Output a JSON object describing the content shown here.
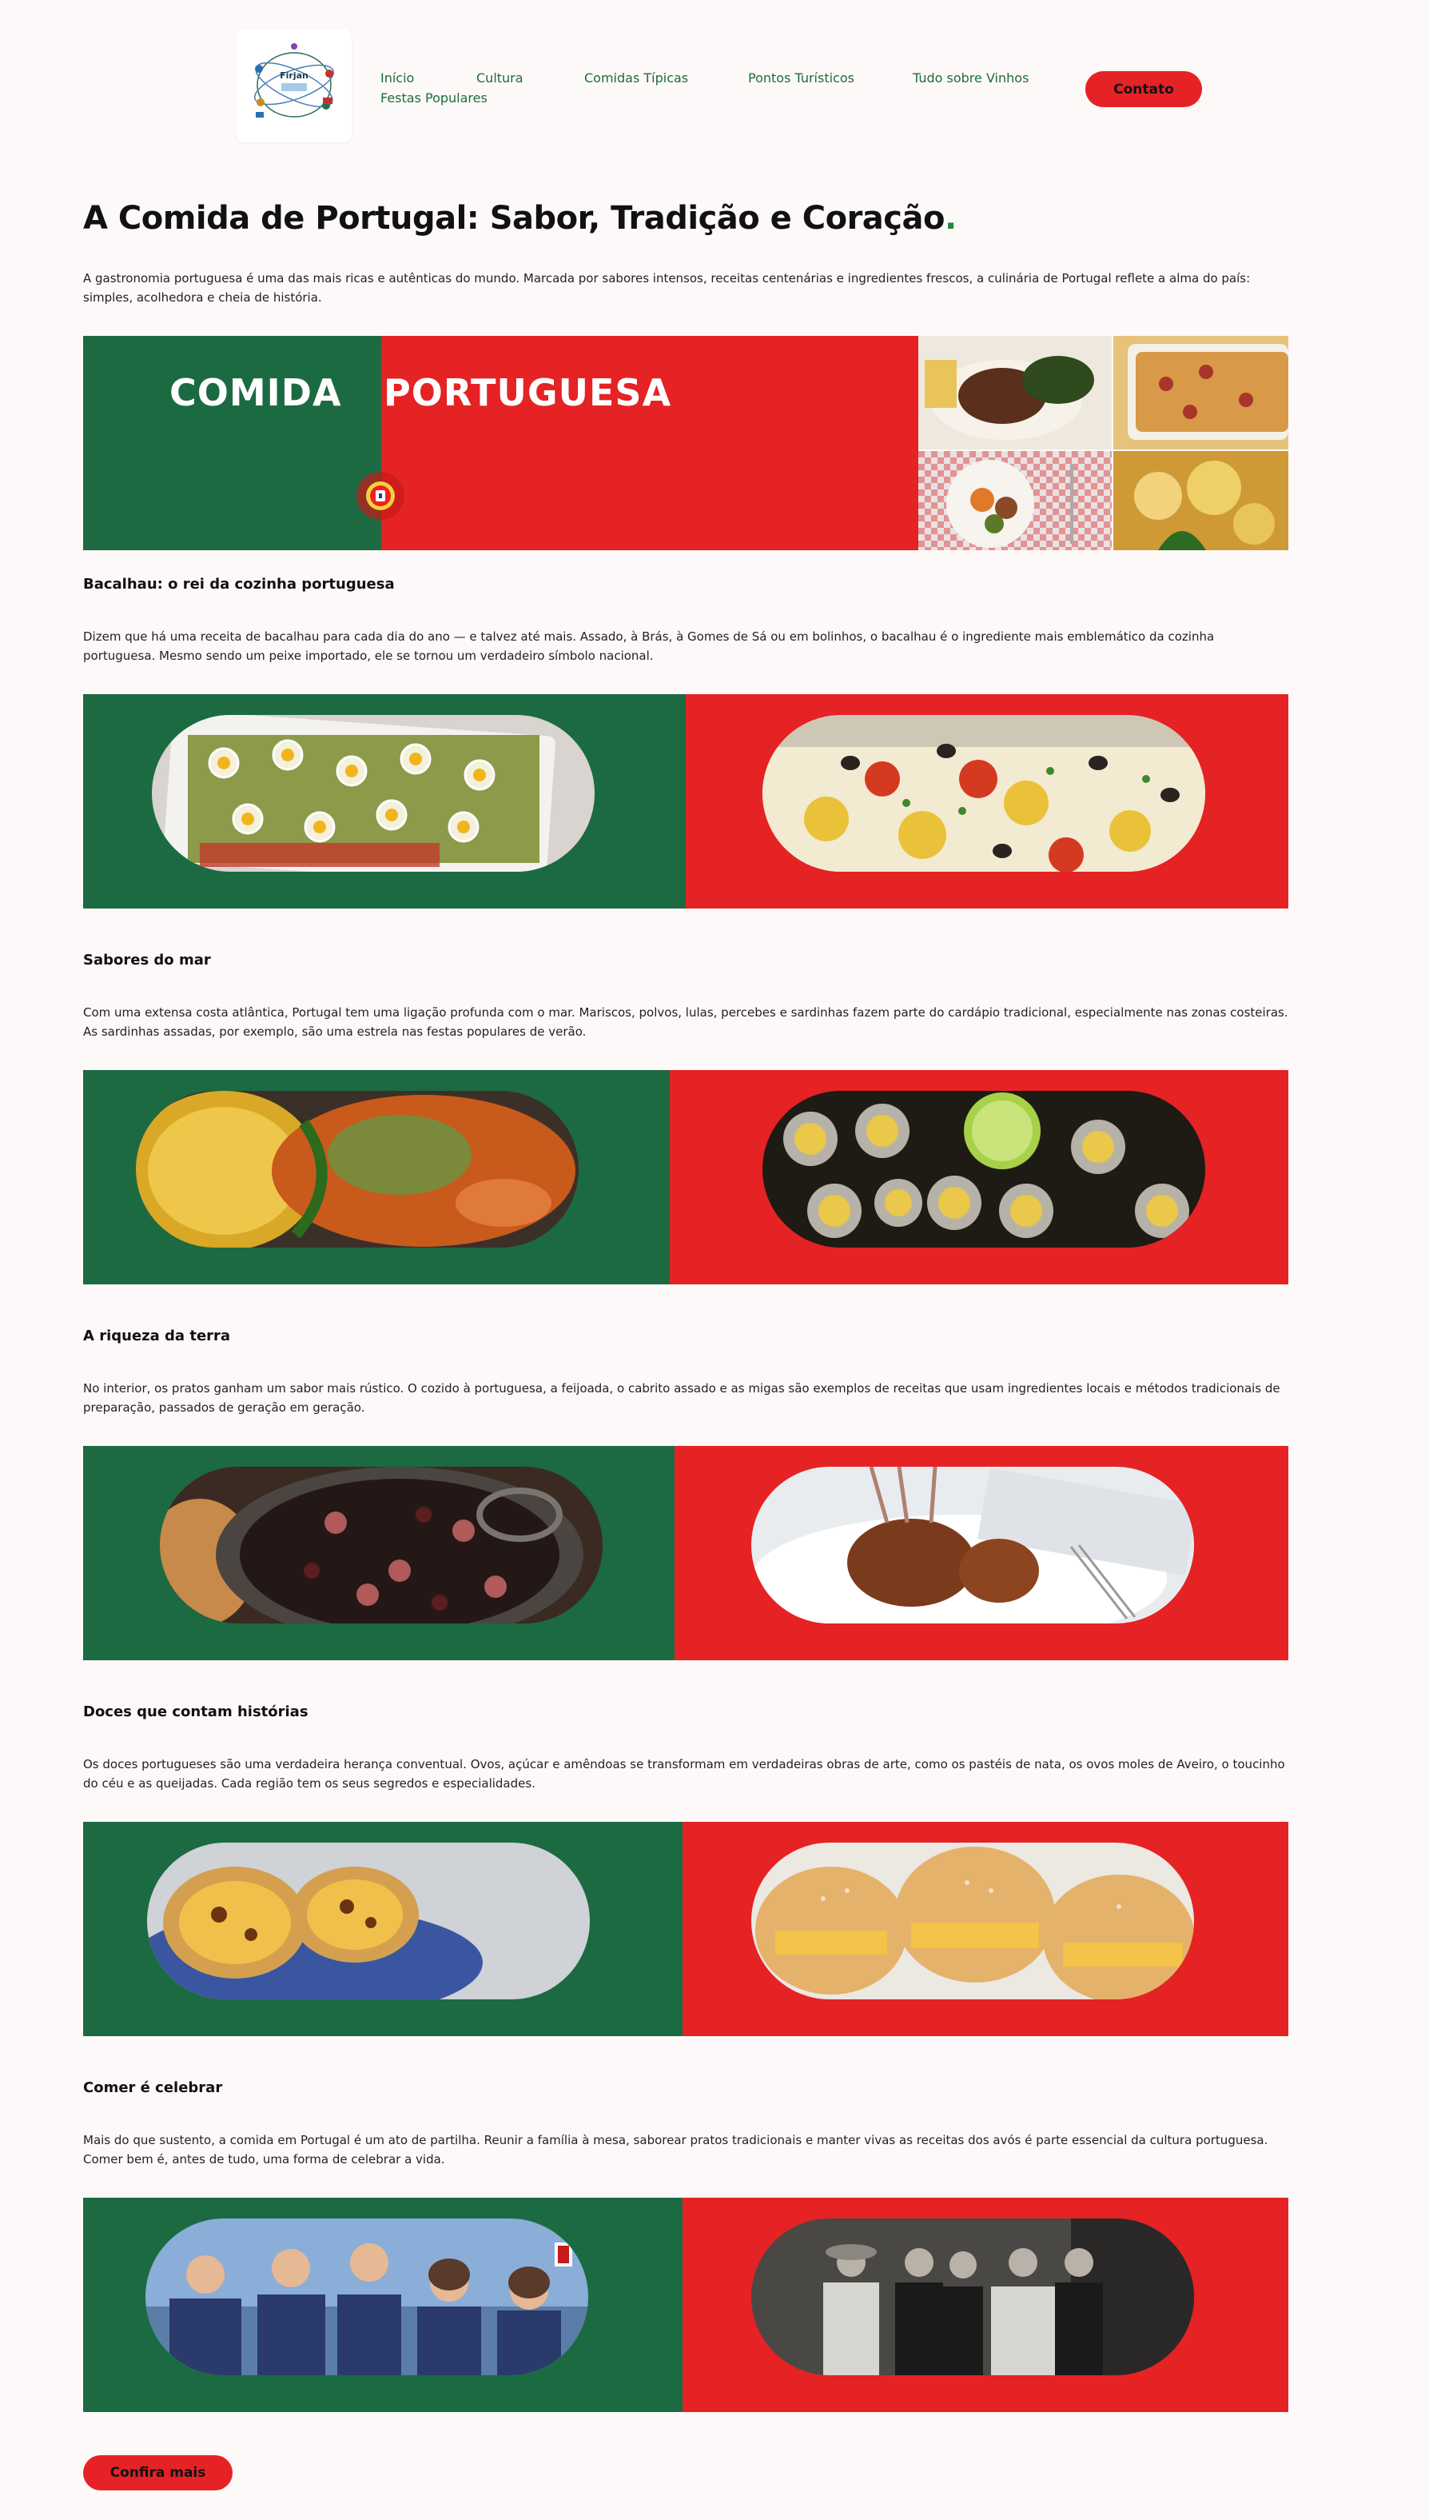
{
  "nav": {
    "logo_text": "Firjan",
    "links": [
      {
        "label": "Início"
      },
      {
        "label": "Cultura"
      },
      {
        "label": "Comidas Típicas"
      },
      {
        "label": "Pontos Turísticos"
      },
      {
        "label": "Tudo sobre Vinhos"
      },
      {
        "label": "Festas Populares"
      }
    ],
    "contact_label": "Contato"
  },
  "page": {
    "title": "A Comida de Portugal: Sabor, Tradição e Coração",
    "title_dot": ".",
    "intro": "A gastronomia portuguesa é uma das mais ricas e autênticas do mundo. Marcada por sabores intensos, receitas centenárias e ingredientes frescos, a culinária de Portugal reflete a alma do país: simples, acolhedora e cheia de história."
  },
  "hero": {
    "word_left": "COMIDA",
    "word_right": "PORTUGUESA"
  },
  "sections": [
    {
      "heading": "Bacalhau: o rei da cozinha portuguesa",
      "text": "Dizem que há uma receita de bacalhau para cada dia do ano — e talvez até mais. Assado, à Brás, à Gomes de Sá ou em bolinhos, o bacalhau é o ingrediente mais emblemático da cozinha portuguesa. Mesmo sendo um peixe importado, ele se tornou um verdadeiro símbolo nacional."
    },
    {
      "heading": "Sabores do mar",
      "text": "Com uma extensa costa atlântica, Portugal tem uma ligação profunda com o mar. Mariscos, polvos, lulas, percebes e sardinhas fazem parte do cardápio tradicional, especialmente nas zonas costeiras. As sardinhas assadas, por exemplo, são uma estrela nas festas populares de verão."
    },
    {
      "heading": "A riqueza da terra",
      "text": "No interior, os pratos ganham um sabor mais rústico. O cozido à portuguesa, a feijoada, o cabrito assado e as migas são exemplos de receitas que usam ingredientes locais e métodos tradicionais de preparação, passados de geração em geração."
    },
    {
      "heading": "Doces que contam histórias",
      "text": "Os doces portugueses são uma verdadeira herança conventual. Ovos, açúcar e amêndoas se transformam em verdadeiras obras de arte, como os pastéis de nata, os ovos moles de Aveiro, o toucinho do céu e as queijadas. Cada região tem os seus segredos e especialidades."
    },
    {
      "heading": "Comer é celebrar",
      "text": "Mais do que sustento, a comida em Portugal é um ato de partilha. Reunir a família à mesa, saborear pratos tradicionais e manter vivas as receitas dos avós é parte essencial da cultura portuguesa. Comer bem é, antes de tudo, uma forma de celebrar a vida."
    }
  ],
  "cta_label": "Confira mais",
  "colors": {
    "green": "#1c6a42",
    "red": "#e52224",
    "background": "#fdf9f8",
    "nav_link": "#1e6b3c"
  }
}
